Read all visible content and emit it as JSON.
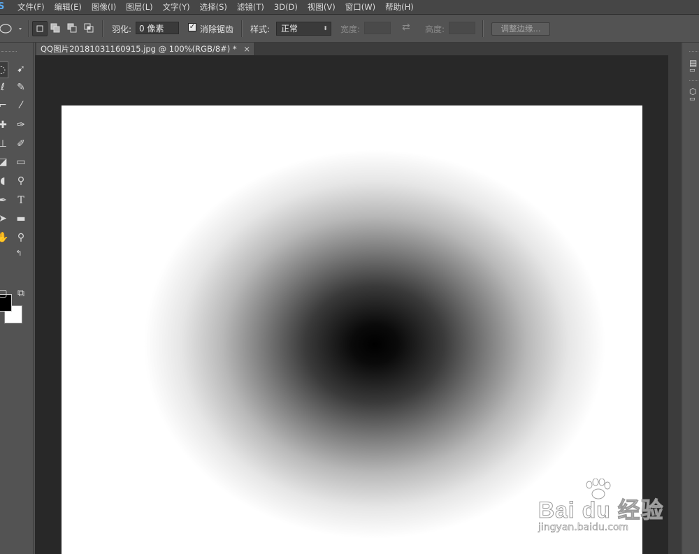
{
  "app": {
    "logo": "S"
  },
  "menu": [
    "文件(F)",
    "编辑(E)",
    "图像(I)",
    "图层(L)",
    "文字(Y)",
    "选择(S)",
    "滤镜(T)",
    "3D(D)",
    "视图(V)",
    "窗口(W)",
    "帮助(H)"
  ],
  "options": {
    "feather_label": "羽化:",
    "feather_value": "0 像素",
    "antialias_label": "消除锯齿",
    "antialias_checked": true,
    "style_label": "样式:",
    "style_value": "正常",
    "width_label": "宽度:",
    "height_label": "高度:",
    "refine_edge_label": "调整边缘..."
  },
  "document": {
    "tab_title": "QQ图片20181031160915.jpg @ 100%(RGB/8#) *",
    "close_glyph": "×"
  },
  "colors": {
    "foreground": "#000000",
    "background": "#ffffff",
    "accent": "#5aa9f0"
  },
  "watermark": {
    "brand": "Bai du 经验",
    "url": "jingyan.baidu.com"
  }
}
